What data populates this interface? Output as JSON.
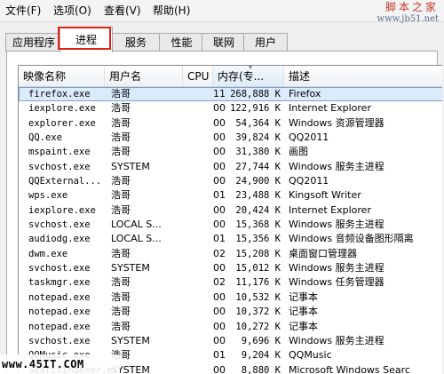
{
  "menu": {
    "items": [
      "文件(F)",
      "选项(O)",
      "查看(V)",
      "帮助(H)"
    ]
  },
  "watermark_top": {
    "line1": "脚本之家",
    "line2": "www.jb51.net"
  },
  "tabs": [
    {
      "label": "应用程序",
      "active": false
    },
    {
      "label": "进程",
      "active": true
    },
    {
      "label": "服务",
      "active": false
    },
    {
      "label": "性能",
      "active": false
    },
    {
      "label": "联网",
      "active": false
    },
    {
      "label": "用户",
      "active": false
    }
  ],
  "table": {
    "columns": [
      "映像名称",
      "用户名",
      "CPU",
      "内存(专...",
      "描述"
    ],
    "sorted_column": 3,
    "rows": [
      {
        "name": "firefox.exe",
        "user": "浩哥",
        "cpu": "11",
        "mem": "268,888 K",
        "desc": "Firefox",
        "selected": true
      },
      {
        "name": "iexplore.exe",
        "user": "浩哥",
        "cpu": "00",
        "mem": "122,916 K",
        "desc": "Internet Explorer"
      },
      {
        "name": "explorer.exe",
        "user": "浩哥",
        "cpu": "00",
        "mem": "54,364 K",
        "desc": "Windows 资源管理器"
      },
      {
        "name": "QQ.exe",
        "user": "浩哥",
        "cpu": "00",
        "mem": "39,824 K",
        "desc": "QQ2011"
      },
      {
        "name": "mspaint.exe",
        "user": "浩哥",
        "cpu": "00",
        "mem": "31,380 K",
        "desc": "画图"
      },
      {
        "name": "svchost.exe",
        "user": "SYSTEM",
        "cpu": "00",
        "mem": "27,744 K",
        "desc": "Windows 服务主进程"
      },
      {
        "name": "QQExternal...",
        "user": "浩哥",
        "cpu": "00",
        "mem": "24,900 K",
        "desc": "QQ2011"
      },
      {
        "name": "wps.exe",
        "user": "浩哥",
        "cpu": "01",
        "mem": "23,488 K",
        "desc": "Kingsoft Writer"
      },
      {
        "name": "iexplore.exe",
        "user": "浩哥",
        "cpu": "00",
        "mem": "20,424 K",
        "desc": "Internet Explorer"
      },
      {
        "name": "svchost.exe",
        "user": "LOCAL S...",
        "cpu": "00",
        "mem": "15,368 K",
        "desc": "Windows 服务主进程"
      },
      {
        "name": "audiodg.exe",
        "user": "LOCAL S...",
        "cpu": "01",
        "mem": "15,356 K",
        "desc": "Windows 音频设备图形隔离"
      },
      {
        "name": "dwm.exe",
        "user": "浩哥",
        "cpu": "02",
        "mem": "15,208 K",
        "desc": "桌面窗口管理器"
      },
      {
        "name": "svchost.exe",
        "user": "SYSTEM",
        "cpu": "00",
        "mem": "15,012 K",
        "desc": "Windows 服务主进程"
      },
      {
        "name": "taskmgr.exe",
        "user": "浩哥",
        "cpu": "02",
        "mem": "11,176 K",
        "desc": "Windows 任务管理器"
      },
      {
        "name": "notepad.exe",
        "user": "浩哥",
        "cpu": "00",
        "mem": "10,532 K",
        "desc": "记事本"
      },
      {
        "name": "notepad.exe",
        "user": "浩哥",
        "cpu": "00",
        "mem": "10,372 K",
        "desc": "记事本"
      },
      {
        "name": "notepad.exe",
        "user": "浩哥",
        "cpu": "00",
        "mem": "10,272 K",
        "desc": "记事本"
      },
      {
        "name": "svchost.exe",
        "user": "SYSTEM",
        "cpu": "00",
        "mem": "9,696 K",
        "desc": "Windows 服务主进程"
      },
      {
        "name": "QQMusic.exe",
        "user": "浩哥",
        "cpu": "01",
        "mem": "9,204 K",
        "desc": "QQMusic"
      },
      {
        "name": "SearchIndexer.exe",
        "user": "SYSTEM",
        "cpu": "00",
        "mem": "8,880 K",
        "desc": "Microsoft Windows Searc"
      }
    ]
  },
  "watermark_bottom": "www.45IT.COM"
}
